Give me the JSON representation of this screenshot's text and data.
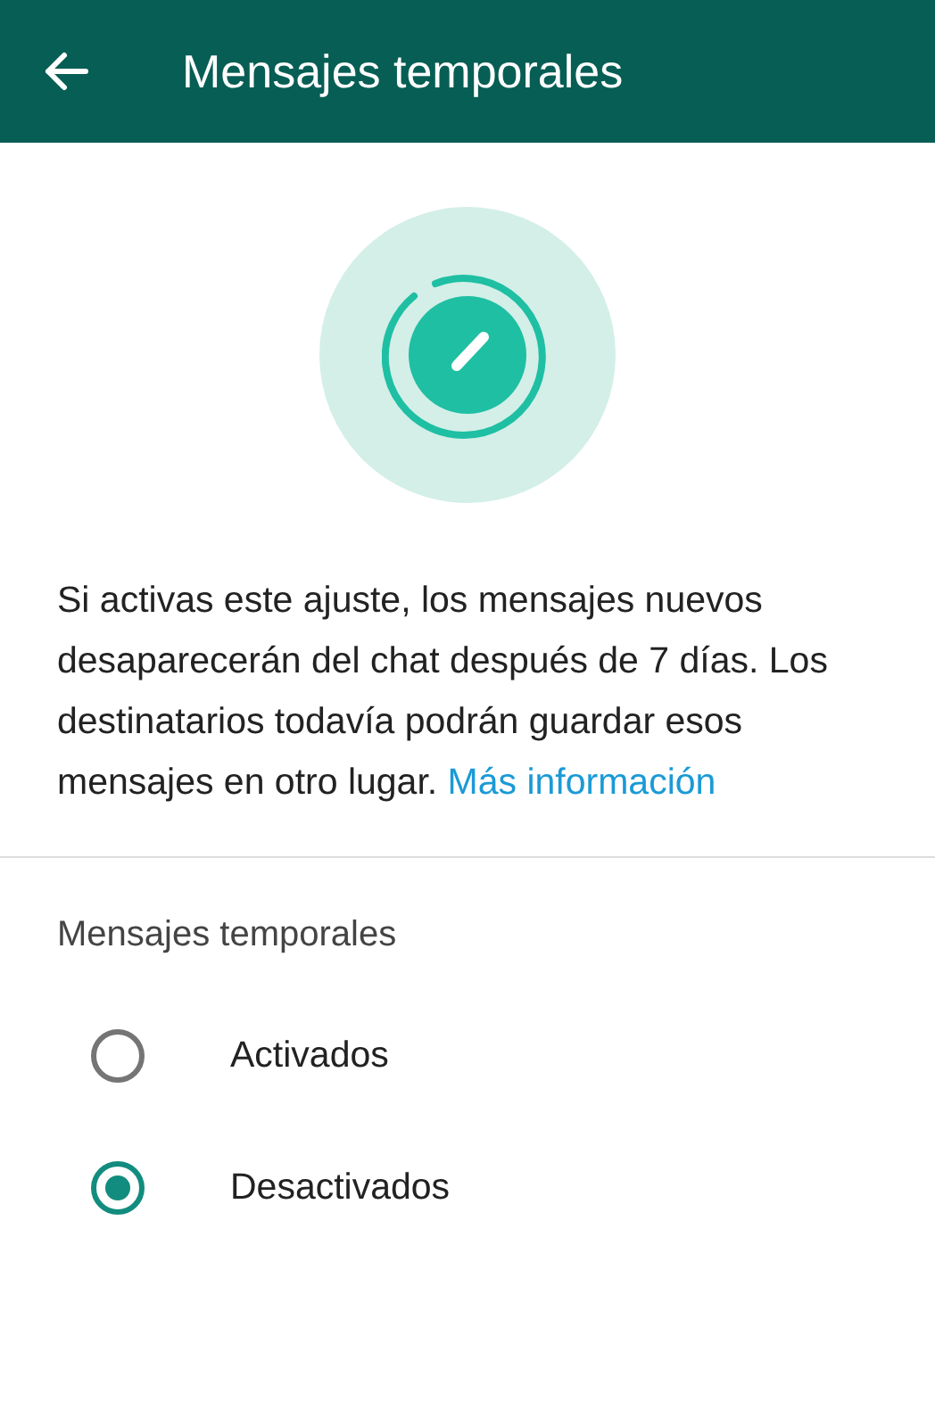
{
  "header": {
    "title": "Mensajes temporales"
  },
  "intro": {
    "text": "Si activas este ajuste, los mensajes nuevos desaparecerán del chat después de 7 días. Los destinatarios todavía podrán guardar esos mensajes en otro lugar.",
    "link": "Más información"
  },
  "section_title": "Mensajes temporales",
  "options": [
    {
      "label": "Activados",
      "selected": false
    },
    {
      "label": "Desactivados",
      "selected": true
    }
  ]
}
